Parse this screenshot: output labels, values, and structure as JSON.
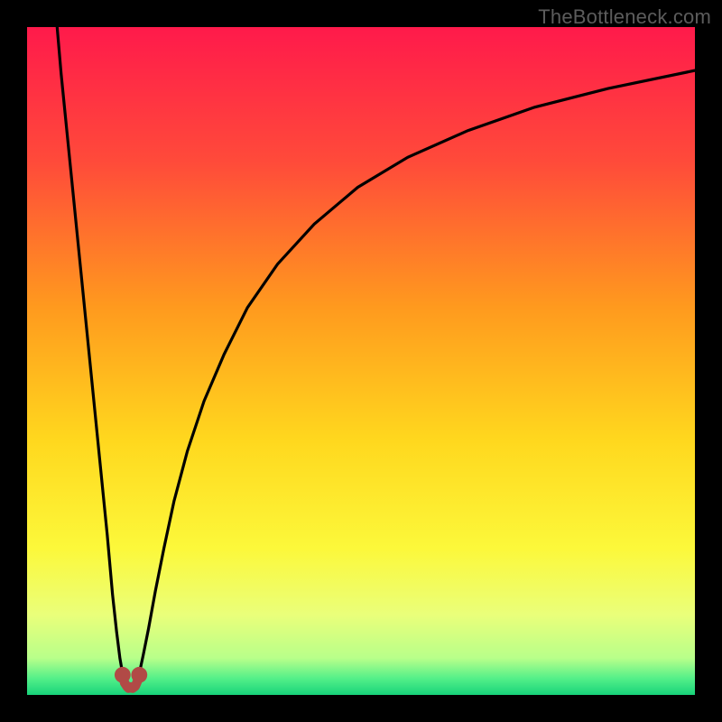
{
  "attribution": "TheBottleneck.com",
  "chart_data": {
    "type": "line",
    "title": "",
    "xlabel": "",
    "ylabel": "",
    "xlim": [
      0,
      100
    ],
    "ylim": [
      0,
      100
    ],
    "optimum_x": 15,
    "gradient_stops": [
      {
        "offset": 0,
        "color": "#ff1a4b"
      },
      {
        "offset": 0.2,
        "color": "#ff4a3a"
      },
      {
        "offset": 0.42,
        "color": "#ff9a1e"
      },
      {
        "offset": 0.62,
        "color": "#ffd81e"
      },
      {
        "offset": 0.78,
        "color": "#fcf83a"
      },
      {
        "offset": 0.88,
        "color": "#eaff7a"
      },
      {
        "offset": 0.945,
        "color": "#b8ff8a"
      },
      {
        "offset": 0.975,
        "color": "#55f089"
      },
      {
        "offset": 1.0,
        "color": "#17d37a"
      }
    ],
    "series": [
      {
        "name": "left-branch",
        "x": [
          4.5,
          5.1,
          6.0,
          7.0,
          8.0,
          9.0,
          10.0,
          11.0,
          12.0,
          12.8,
          13.4,
          13.9,
          14.3
        ],
        "values": [
          100,
          93,
          84,
          74,
          64,
          54,
          44,
          34,
          24,
          15,
          9.5,
          5.5,
          3.2
        ]
      },
      {
        "name": "right-branch",
        "x": [
          16.8,
          17.4,
          18.2,
          19.2,
          20.5,
          22.0,
          24.0,
          26.5,
          29.5,
          33.0,
          37.5,
          43.0,
          49.5,
          57.0,
          66.0,
          76.0,
          87.0,
          100.0
        ],
        "values": [
          3.2,
          6.0,
          10.0,
          15.5,
          22.0,
          29.0,
          36.5,
          44.0,
          51.0,
          58.0,
          64.5,
          70.5,
          76.0,
          80.5,
          84.5,
          88.0,
          90.8,
          93.5
        ]
      }
    ],
    "markers": [
      {
        "name": "optimum-left-dot",
        "x": 14.3,
        "y": 3.0,
        "r": 1.2,
        "color": "#b14a46"
      },
      {
        "name": "optimum-right-dot",
        "x": 16.8,
        "y": 3.0,
        "r": 1.2,
        "color": "#b14a46"
      }
    ],
    "dip_connector": {
      "color": "#b14a46",
      "width": 1.4,
      "points_x": [
        14.3,
        14.6,
        15.0,
        15.2,
        15.5,
        15.8,
        16.2,
        16.5,
        16.8
      ],
      "points_y": [
        3.0,
        1.8,
        1.2,
        1.0,
        1.2,
        1.0,
        1.3,
        2.0,
        3.0
      ]
    }
  }
}
